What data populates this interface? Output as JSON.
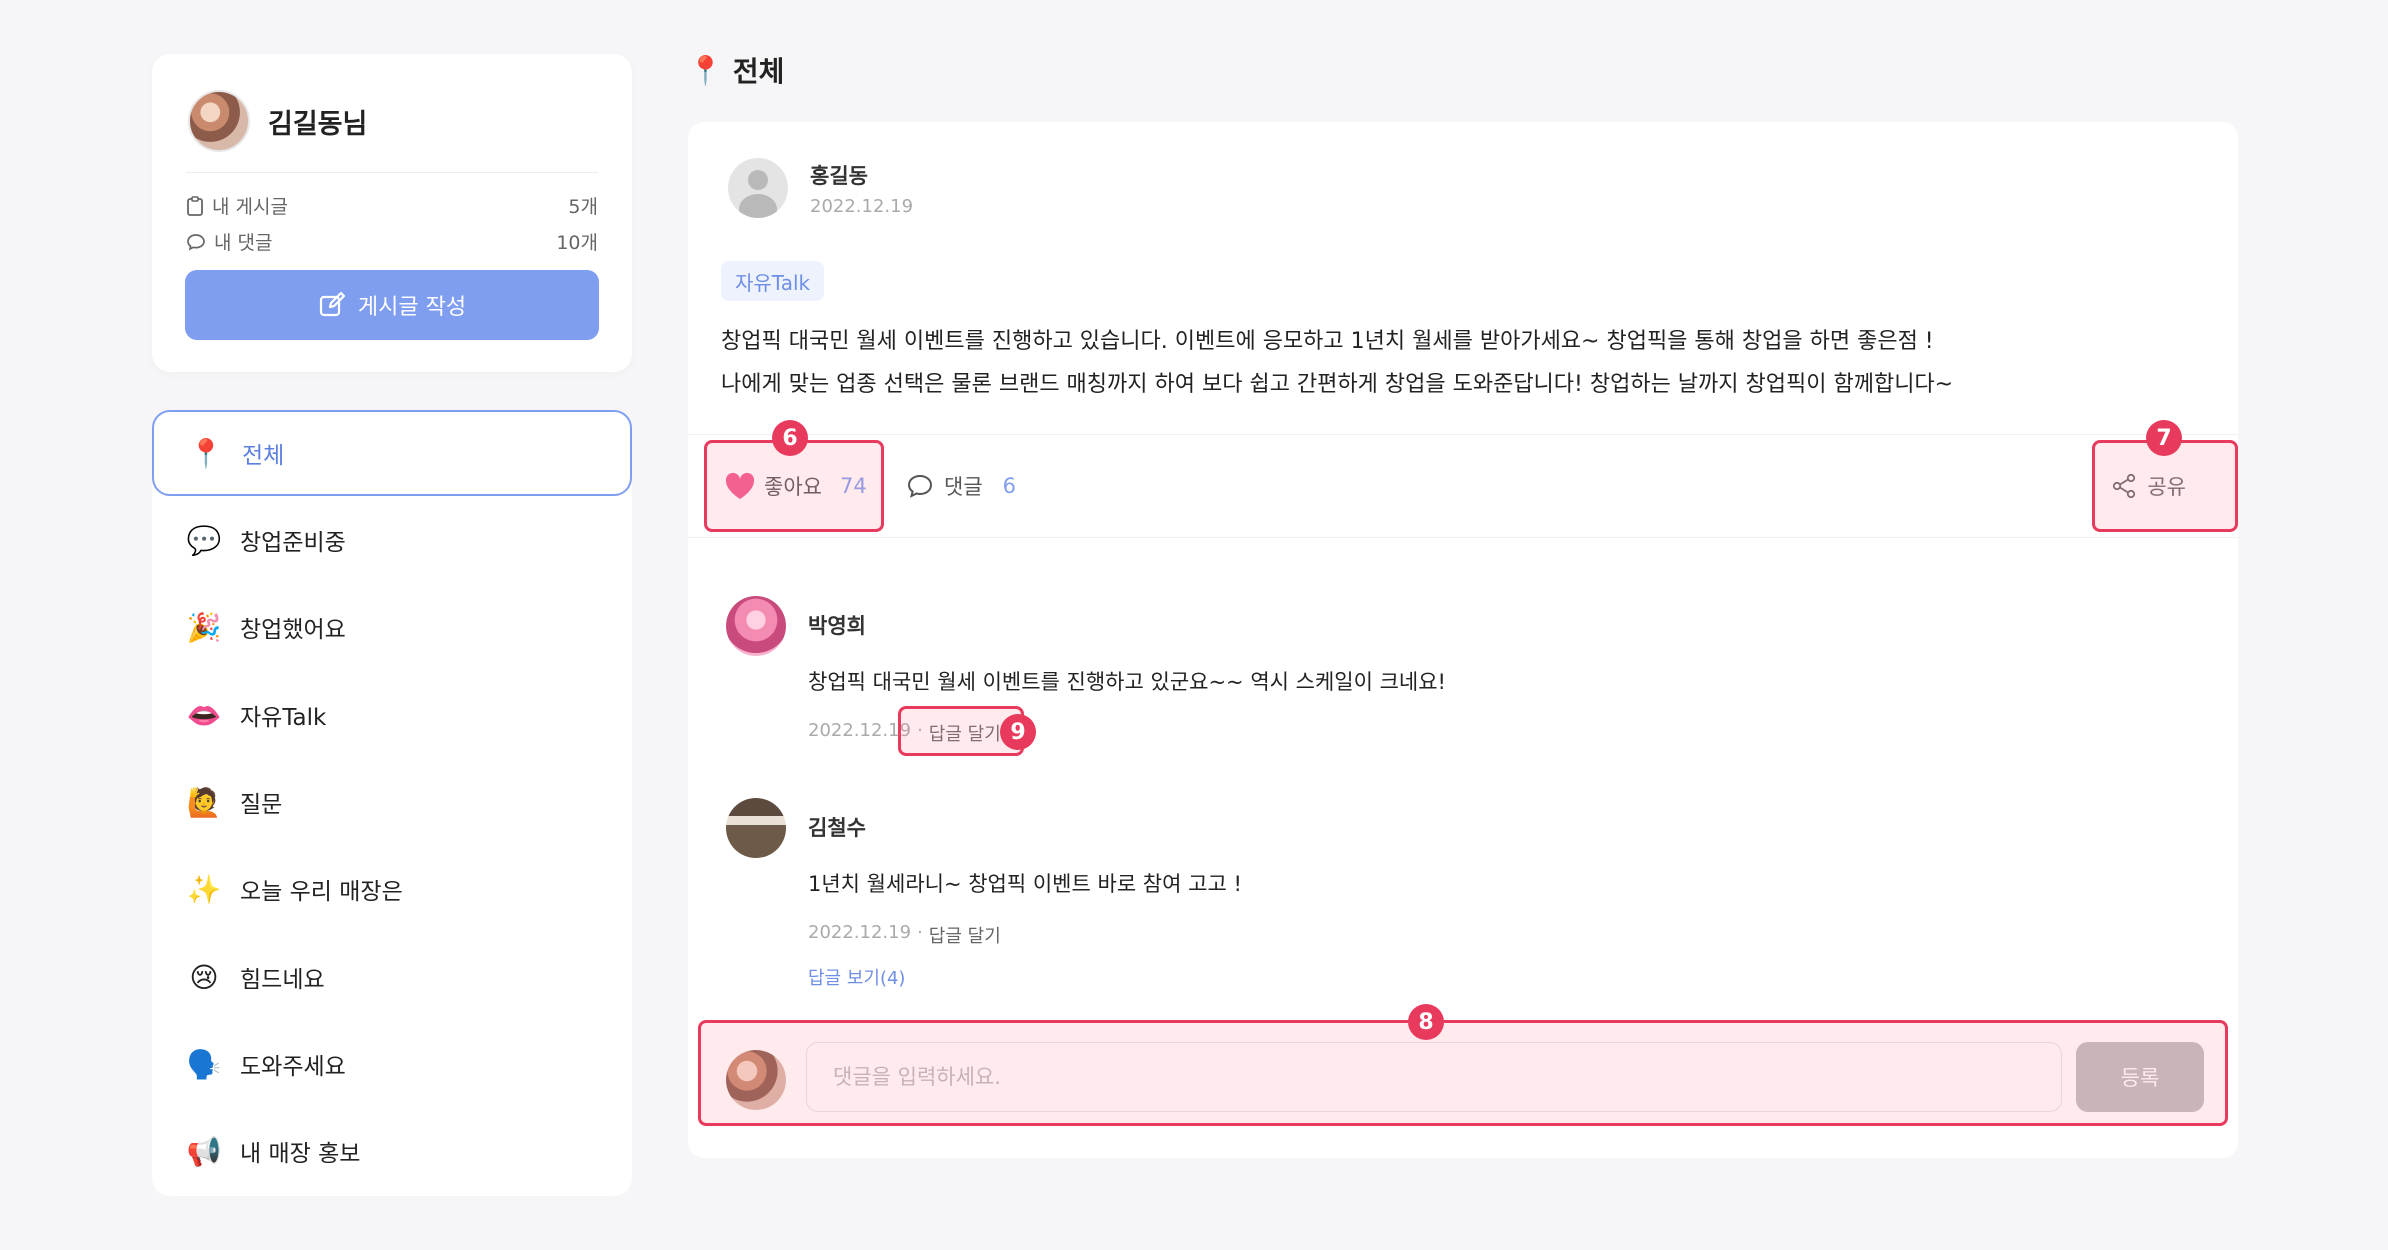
{
  "profile": {
    "name": "김길동님",
    "stats": [
      {
        "label": "내 게시글",
        "value": "5개",
        "icon": "clipboard-icon"
      },
      {
        "label": "내 댓글",
        "value": "10개",
        "icon": "speech-bubble-icon"
      }
    ],
    "write_button": "게시글 작성"
  },
  "categories": [
    {
      "emoji": "📍",
      "label": "전체",
      "active": true
    },
    {
      "emoji": "💬",
      "label": "창업준비중"
    },
    {
      "emoji": "🎉",
      "label": "창업했어요"
    },
    {
      "emoji": "👄",
      "label": "자유Talk"
    },
    {
      "emoji": "🙋",
      "label": "질문"
    },
    {
      "emoji": "✨",
      "label": "오늘 우리 매장은"
    },
    {
      "emoji": "😢",
      "label": "힘드네요"
    },
    {
      "emoji": "🗣️",
      "label": "도와주세요"
    },
    {
      "emoji": "📢",
      "label": "내 매장 홍보"
    }
  ],
  "page": {
    "title_emoji": "📍",
    "title": "전체"
  },
  "post": {
    "author": "홍길동",
    "date": "2022.12.19",
    "tag": "자유Talk",
    "body_lines": [
      "창업픽 대국민 월세 이벤트를 진행하고 있습니다.  이벤트에 응모하고 1년치 월세를 받아가세요~ 창업픽을 통해 창업을 하면 좋은점 !",
      "나에게 맞는 업종 선택은 물론 브랜드 매칭까지 하여 보다 쉽고 간편하게 창업을 도와준답니다! 창업하는 날까지 창업픽이 함께합니다~"
    ],
    "like_label": "좋아요",
    "like_count": "74",
    "comment_label": "댓글",
    "comment_count": "6",
    "share_label": "공유"
  },
  "comments": [
    {
      "name": "박영희",
      "text": "창업픽 대국민 월세 이벤트를 진행하고 있군요~~ 역시 스케일이 크네요!",
      "date": "2022.12.19",
      "reply": "답글 달기"
    },
    {
      "name": "김철수",
      "text": "1년치 월세라니~ 창업픽 이벤트 바로 참여 고고 !",
      "date": "2022.12.19",
      "reply": "답글 달기",
      "more": "답글 보기(4)"
    }
  ],
  "comment_input": {
    "placeholder": "댓글을 입력하세요.",
    "submit": "등록"
  },
  "annotations": {
    "like": "6",
    "share": "7",
    "input": "8",
    "reply": "9"
  },
  "colors": {
    "accent": "#809ef0",
    "highlight": "#e83a5d",
    "heart": "#f1588a"
  }
}
